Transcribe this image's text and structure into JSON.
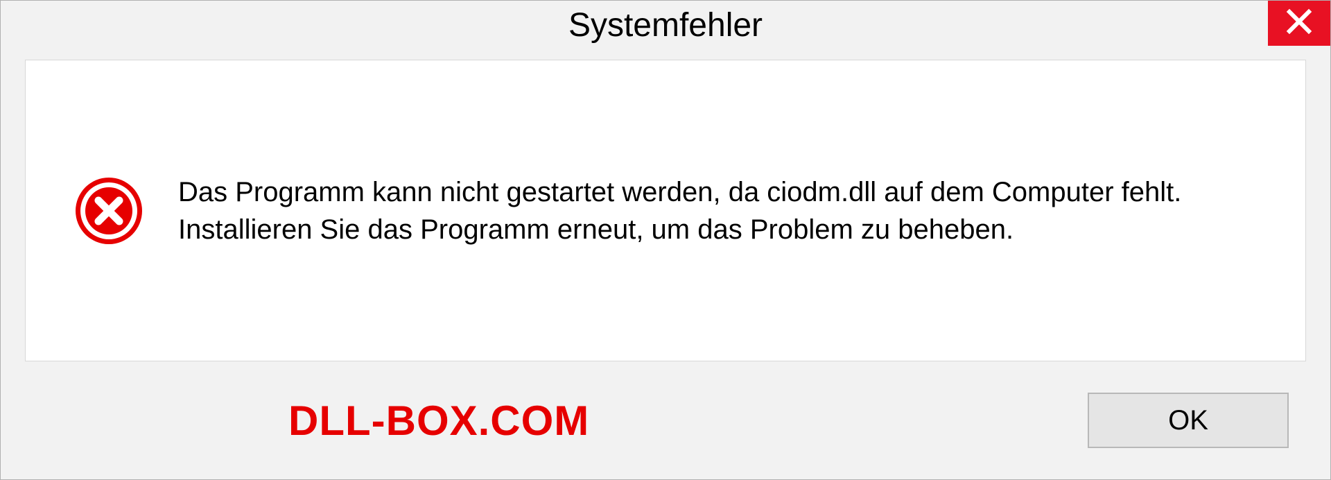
{
  "dialog": {
    "title": "Systemfehler",
    "message": "Das Programm kann nicht gestartet werden, da ciodm.dll auf dem Computer fehlt. Installieren Sie das Programm erneut, um das Problem zu beheben.",
    "ok_label": "OK"
  },
  "watermark": "DLL-BOX.COM"
}
